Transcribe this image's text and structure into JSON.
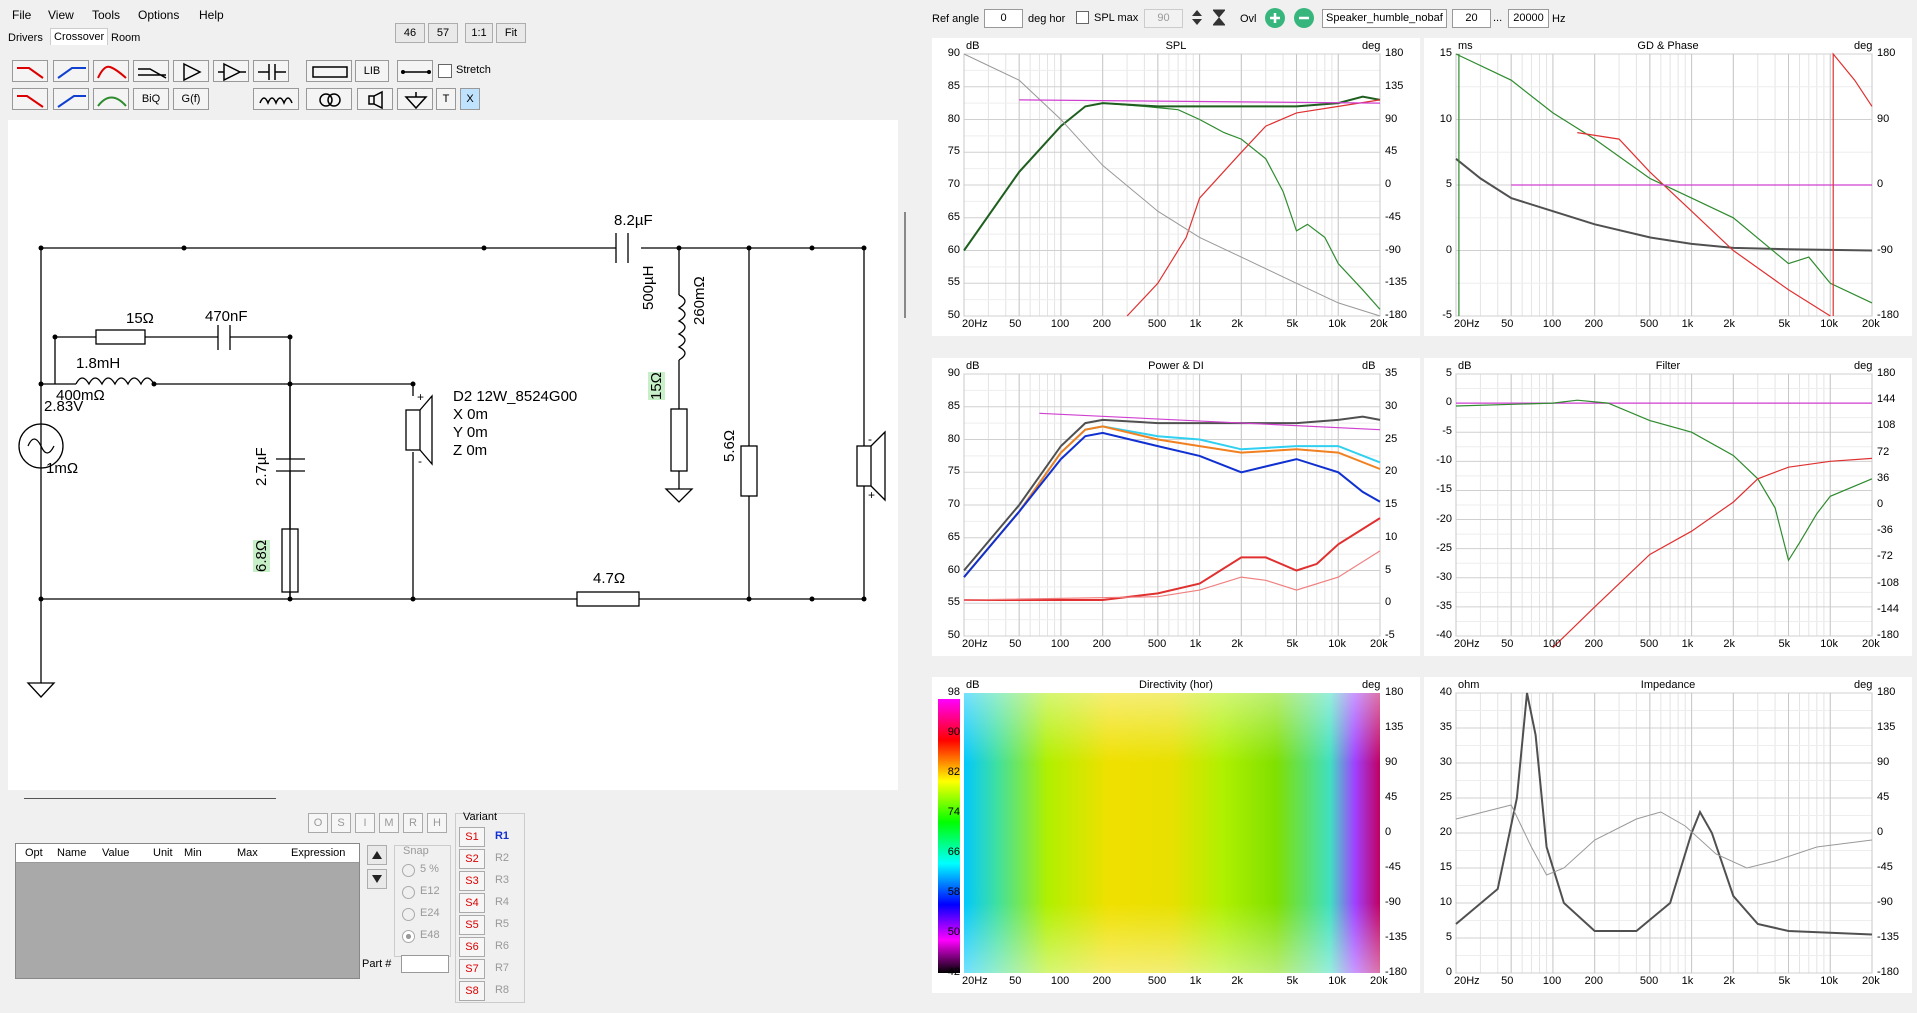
{
  "menu": [
    "File",
    "View",
    "Tools",
    "Options",
    "Help"
  ],
  "top_buttons": [
    "46",
    "57",
    "1:1",
    "Fit"
  ],
  "tabs": [
    "Drivers",
    "Crossover",
    "Room"
  ],
  "toolbar": {
    "lib": "LIB",
    "biq": "BiQ",
    "gf": "G(f)",
    "t": "T",
    "x": "X",
    "stretch": "Stretch"
  },
  "ref_bar": {
    "ref_angle_label": "Ref angle",
    "ref_angle": "0",
    "deg_hor": "deg hor",
    "spl_max_label": "SPL max",
    "spl_max": "90",
    "ovl": "Ovl",
    "project": "Speaker_humble_nobaf",
    "f_low": "20",
    "dots": "...",
    "f_high": "20000",
    "hz": "Hz"
  },
  "schematic": {
    "c1": "8.2µF",
    "l1": "500µH",
    "l1r": "260mΩ",
    "r1": "15Ω",
    "r2": "5.6Ω",
    "r3": "15Ω",
    "c2": "470nF",
    "l2": "1.8mH",
    "l2r": "400mΩ",
    "v": "2.83V",
    "vr": "1mΩ",
    "c3": "2.7µF",
    "r4": "6.8Ω",
    "r5": "4.7Ω",
    "driver": "D2 12W_8524G00",
    "x": "X 0m",
    "y": "Y 0m",
    "z": "Z 0m"
  },
  "grid_headers": [
    "Opt",
    "Name",
    "Value",
    "Unit",
    "Min",
    "Max",
    "Expression"
  ],
  "grid_buttons": [
    "O",
    "S",
    "I",
    "M",
    "R",
    "H"
  ],
  "snap": {
    "title": "Snap",
    "options": [
      "5 %",
      "E12",
      "E24",
      "E48"
    ]
  },
  "variant": {
    "title": "Variant",
    "s": [
      "S1",
      "S2",
      "S3",
      "S4",
      "S5",
      "S6",
      "S7",
      "S8"
    ],
    "r": [
      "R1",
      "R2",
      "R3",
      "R4",
      "R5",
      "R6",
      "R7",
      "R8"
    ]
  },
  "part_label": "Part #",
  "freq_ticks": [
    "20Hz",
    "50",
    "100",
    "200",
    "500",
    "1k",
    "2k",
    "5k",
    "10k",
    "20k"
  ],
  "colors": {
    "green": "#2e8b2e",
    "darkgreen": "#1f5f1f",
    "red": "#e03030",
    "magenta": "#d040d0",
    "gray": "#999999",
    "dark": "#505050",
    "blue": "#1030d0",
    "cyan": "#30d0f0",
    "orange": "#f08020"
  },
  "plots": {
    "spl": {
      "title": "SPL",
      "lunit": "dB",
      "runit": "deg",
      "left": [
        "90",
        "85",
        "80",
        "75",
        "70",
        "65",
        "60",
        "55",
        "50"
      ],
      "right": [
        "180",
        "135",
        "90",
        "45",
        "0",
        "-45",
        "-90",
        "-135",
        "-180"
      ]
    },
    "gd": {
      "title": "GD & Phase",
      "lunit": "ms",
      "runit": "deg",
      "left": [
        "15",
        "10",
        "5",
        "0",
        "-5"
      ],
      "right": [
        "180",
        "90",
        "0",
        "-90",
        "-180"
      ]
    },
    "power": {
      "title": "Power & DI",
      "lunit": "dB",
      "runit": "dB",
      "left": [
        "90",
        "85",
        "80",
        "75",
        "70",
        "65",
        "60",
        "55",
        "50"
      ],
      "right": [
        "35",
        "30",
        "25",
        "20",
        "15",
        "10",
        "5",
        "0",
        "-5"
      ]
    },
    "filter": {
      "title": "Filter",
      "lunit": "dB",
      "runit": "deg",
      "left": [
        "5",
        "0",
        "-5",
        "-10",
        "-15",
        "-20",
        "-25",
        "-30",
        "-35",
        "-40"
      ],
      "right": [
        "180",
        "144",
        "108",
        "72",
        "36",
        "0",
        "-36",
        "-72",
        "-108",
        "-144",
        "-180"
      ]
    },
    "dir": {
      "title": "Directivity (hor)",
      "lunit": "dB",
      "runit": "deg",
      "left": [
        "98",
        "90",
        "82",
        "74",
        "66",
        "58",
        "50",
        "42"
      ],
      "right": [
        "180",
        "135",
        "90",
        "45",
        "0",
        "-45",
        "-90",
        "-135",
        "-180"
      ]
    },
    "imp": {
      "title": "Impedance",
      "lunit": "ohm",
      "runit": "deg",
      "left": [
        "40",
        "35",
        "30",
        "25",
        "20",
        "15",
        "10",
        "5",
        "0"
      ],
      "right": [
        "180",
        "135",
        "90",
        "45",
        "0",
        "-45",
        "-90",
        "-135",
        "-180"
      ]
    }
  }
}
